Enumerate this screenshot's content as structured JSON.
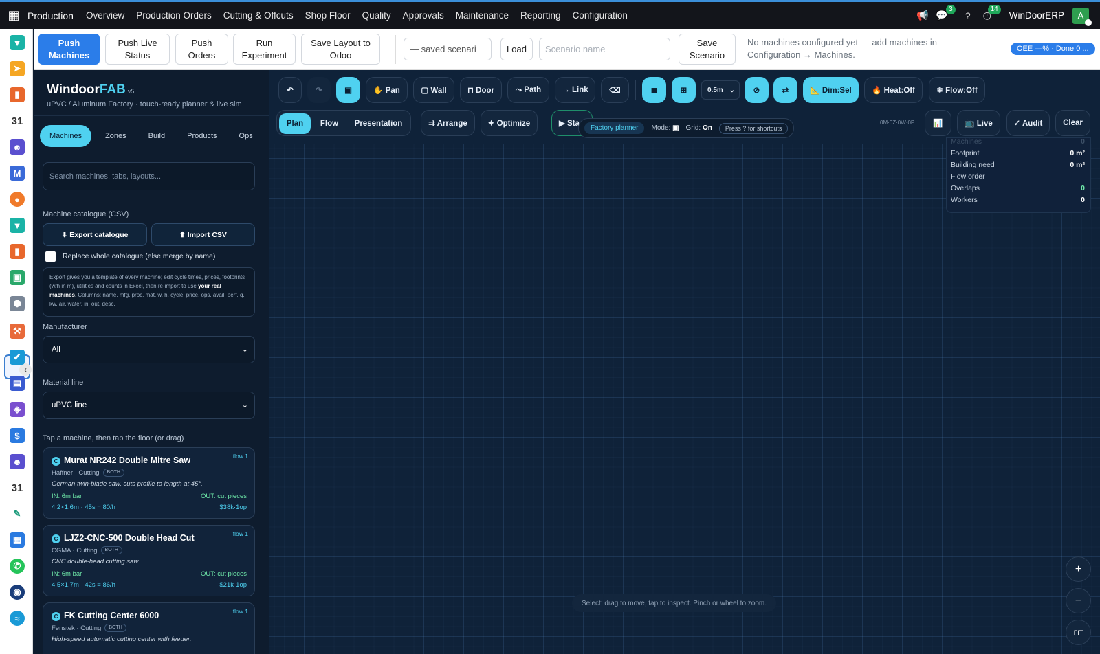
{
  "topbar": {
    "app_name": "Production",
    "menu": [
      "Overview",
      "Production Orders",
      "Cutting & Offcuts",
      "Shop Floor",
      "Quality",
      "Approvals",
      "Maintenance",
      "Reporting",
      "Configuration"
    ],
    "messages_count": "3",
    "activities_count": "14",
    "company": "WinDoorERP",
    "avatar_letter": "A"
  },
  "controls": {
    "push_machines": "Push Machines",
    "push_live_status": "Push Live Status",
    "push_orders": "Push Orders",
    "run_experiment": "Run Experiment",
    "save_layout": "Save Layout to Odoo",
    "scenario_select": "— saved scenari",
    "load": "Load",
    "scenario_name_placeholder": "Scenario name",
    "save_scenario": "Save Scenario",
    "message": "No machines configured yet — add machines in Configuration → Machines.",
    "oee": "OEE —% · Done 0 ..."
  },
  "sidebar": {
    "brand_main": "Windoor",
    "brand_accent": "FAB",
    "brand_version": "v5",
    "subtitle": "uPVC / Aluminum Factory · touch-ready planner & live sim",
    "tabs": [
      "Machines",
      "Zones",
      "Build",
      "Products",
      "Ops"
    ],
    "search_placeholder": "Search machines, tabs, layouts...",
    "catalogue_label": "Machine catalogue (CSV)",
    "export_btn": "⬇ Export catalogue",
    "import_btn": "⬆ Import CSV",
    "replace_label": "Replace whole catalogue (else merge by name)",
    "info_text_1": "Export gives you a template of every machine; edit cycle times, prices, footprints (w/h in m), utilities and counts in Excel, then re-import to use ",
    "info_bold": "your real machines",
    "info_text_2": ". Columns: name, mfg, proc, mat, w, h, cycle, price, ops, avail, perf, q, kw, air, water, in, out, desc.",
    "manufacturer_label": "Manufacturer",
    "manufacturer_value": "All",
    "material_label": "Material line",
    "material_value": "uPVC line",
    "tap_hint": "Tap a machine, then tap the floor (or drag)"
  },
  "machines": [
    {
      "badge": "C",
      "name": "Murat NR242 Double Mitre Saw",
      "flow": "flow 1",
      "mfg": "Haffner · Cutting",
      "tag": "BOTH",
      "desc": "German twin-blade saw, cuts profile to length at 45°.",
      "in": "IN: 6m bar",
      "out": "OUT: cut pieces",
      "spec": "4.2×1.6m · 45s = 80/h",
      "price": "$38k·1op"
    },
    {
      "badge": "C",
      "name": "LJZ2-CNC-500 Double Head Cut",
      "flow": "flow 1",
      "mfg": "CGMA · Cutting",
      "tag": "BOTH",
      "desc": "CNC double-head cutting saw.",
      "in": "IN: 6m bar",
      "out": "OUT: cut pieces",
      "spec": "4.5×1.7m · 42s = 86/h",
      "price": "$21k·1op"
    },
    {
      "badge": "C",
      "name": "FK Cutting Center 6000",
      "flow": "flow 1",
      "mfg": "Fenstek · Cutting",
      "tag": "BOTH",
      "desc": "High-speed automatic cutting center with feeder.",
      "in": "",
      "out": "",
      "spec": "",
      "price": ""
    }
  ],
  "toolbar": {
    "undo": "↶",
    "redo": "↷",
    "select": "▣",
    "pan": "✋ Pan",
    "wall": "▢ Wall",
    "door": "⊓ Door",
    "path": "⤳ Path",
    "link": "→ Link",
    "erase": "⌫",
    "snap": "◼",
    "grid": "⊞",
    "grid_size": "0.5m",
    "no_entry": "⊘",
    "swap": "⇄",
    "dim": "📐 Dim:Sel",
    "heat": "🔥 Heat:Off",
    "flow": "❄ Flow:Off",
    "modes": [
      "Plan",
      "Flow",
      "Presentation"
    ],
    "arrange": "⇉ Arrange",
    "optimize": "✦ Optimize",
    "start": "▶ Sta",
    "chart": "📊",
    "live": "📺 Live",
    "audit": "✓ Audit",
    "clear": "Clear",
    "coord": "0M·0Z·0W·0P"
  },
  "hint": {
    "pill": "Factory planner",
    "mode_label": "Mode:",
    "mode_value": "▣",
    "grid_label": "Grid:",
    "grid_value": "On",
    "shortcut": "Press ? for shortcuts"
  },
  "stats": [
    {
      "k": "Machines",
      "v": "0"
    },
    {
      "k": "Footprint",
      "v": "0 m²"
    },
    {
      "k": "Building need",
      "v": "0 m²"
    },
    {
      "k": "Flow order",
      "v": "—"
    },
    {
      "k": "Overlaps",
      "v": "0"
    },
    {
      "k": "Workers",
      "v": "0"
    }
  ],
  "zoom": {
    "in": "+",
    "out": "−",
    "fit": "FIT"
  },
  "status_msg": "Select: drag to move, tap to inspect. Pinch or wheel to zoom.",
  "colors": {
    "accent": "#4fd1f0",
    "primary": "#2b7de9",
    "canvas": "#0f2239",
    "green": "#6ee7a8"
  }
}
